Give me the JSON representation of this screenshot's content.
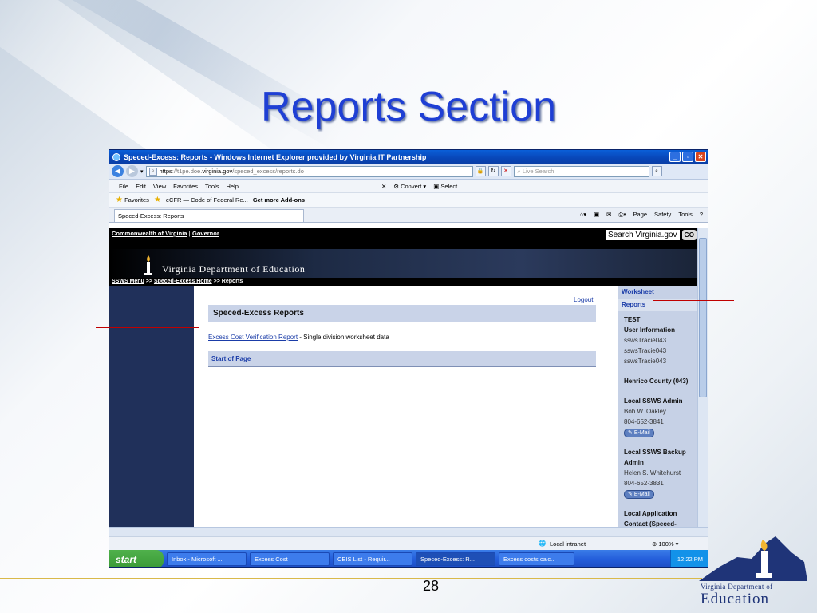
{
  "slide": {
    "title": "Reports Section",
    "page_number": "28"
  },
  "browser": {
    "window_title": "Speced-Excess: Reports - Windows Internet Explorer provided by Virginia IT Partnership",
    "url_scheme": "https",
    "url_host_pre": "://t1pe.doe.",
    "url_host_bold": "virginia.gov",
    "url_path": "/speced_excess/reports.do",
    "search_placeholder": "Live Search",
    "menu": [
      "File",
      "Edit",
      "View",
      "Favorites",
      "Tools",
      "Help"
    ],
    "convert_label": "Convert",
    "select_label": "Select",
    "favorites_label": "Favorites",
    "fav_items": [
      "eCFR — Code of Federal Re...",
      "Get more Add-ons"
    ],
    "tab_title": "Speced-Excess: Reports",
    "tab_tools": [
      "Page",
      "Safety",
      "Tools"
    ],
    "status_zone": "Local intranet",
    "zoom": "100%"
  },
  "site": {
    "top_links": [
      "Commonwealth of Virginia",
      "Governor"
    ],
    "search_button": "Search Virginia.gov",
    "go_label": "GO",
    "header_name": "Virginia Department of Education",
    "breadcrumb": [
      "SSWS Menu",
      ">>",
      "Speced-Excess Home",
      ">> Reports"
    ],
    "logout": "Logout",
    "main_heading": "Speced-Excess Reports",
    "report_link": "Excess Cost Verification Report",
    "report_desc": " - Single division worksheet data",
    "start_of_page": "Start of Page"
  },
  "right_nav": {
    "worksheet": "Worksheet",
    "reports": "Reports",
    "test": "TEST",
    "user_info": "User Information",
    "user_lines": [
      "sswsTracie043",
      "sswsTracie043",
      "sswsTracie043"
    ],
    "county": "Henrico County (043)",
    "admin_heading": "Local SSWS Admin",
    "admin_name": "Bob W. Oakley",
    "admin_phone": "804-652-3841",
    "email_label": "E-Mail",
    "backup_heading": "Local SSWS Backup Admin",
    "backup_name": "Helen S. Whitehurst",
    "backup_phone": "804-652-3831",
    "app_contact": "Local Application Contact (Speced-"
  },
  "taskbar": {
    "start": "start",
    "items": [
      "Inbox - Microsoft ...",
      "Excess Cost",
      "CEIS List - Requir...",
      "Speced-Excess: R...",
      "Excess costs calc..."
    ],
    "clock": "12:22 PM"
  },
  "logo": {
    "line1": "Virginia Department of",
    "line2": "Education"
  }
}
